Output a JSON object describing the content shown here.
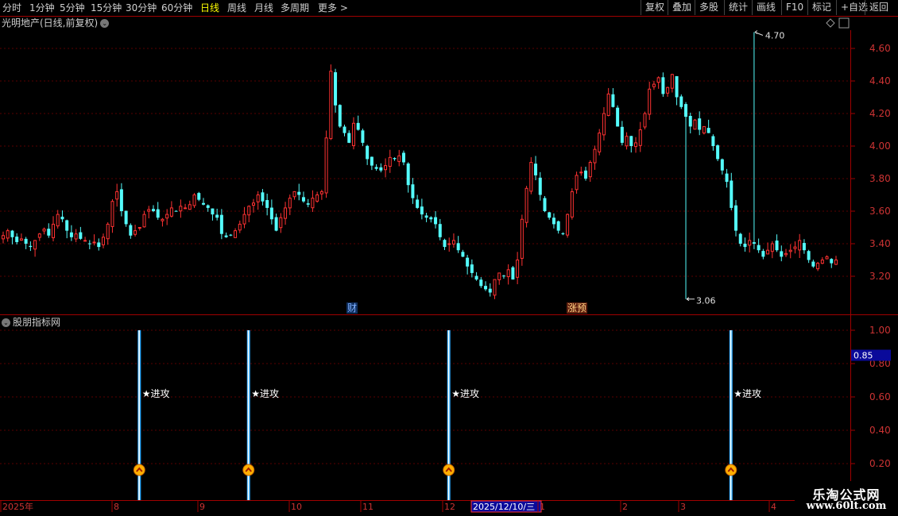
{
  "toolbar": {
    "periods": [
      "分时",
      "1分钟",
      "5分钟",
      "15分钟",
      "30分钟",
      "60分钟",
      "日线",
      "周线",
      "月线",
      "多周期",
      "更多 >"
    ],
    "active_period": "日线",
    "buttons": [
      "复权",
      "叠加",
      "多股",
      "统计",
      "画线",
      "F10",
      "标记",
      "+自选",
      "返回"
    ]
  },
  "main_title": "光明地产(日线,前复权)",
  "indicator_title": "股朋指标网",
  "watermark": {
    "line1": "乐淘公式网",
    "line2": "www.60lt.com"
  },
  "chart_data": [
    {
      "type": "candlestick",
      "title": "光明地产(日线,前复权)",
      "y_ticks": [
        "4.60",
        "4.40",
        "4.20",
        "4.00",
        "3.80",
        "3.60",
        "3.40",
        "3.20"
      ],
      "ylim": [
        3.0,
        4.75
      ],
      "max_label": "4.70",
      "min_label": "3.06",
      "event_markers": [
        "财",
        "涨预"
      ],
      "up_color": "#ff3232",
      "down_color": "#54fcfc",
      "closes": [
        3.45,
        3.48,
        3.44,
        3.41,
        3.43,
        3.4,
        3.38,
        3.42,
        3.46,
        3.49,
        3.45,
        3.52,
        3.58,
        3.55,
        3.48,
        3.44,
        3.46,
        3.43,
        3.42,
        3.4,
        3.41,
        3.38,
        3.44,
        3.52,
        3.66,
        3.72,
        3.6,
        3.52,
        3.45,
        3.48,
        3.5,
        3.58,
        3.61,
        3.6,
        3.56,
        3.55,
        3.58,
        3.62,
        3.6,
        3.63,
        3.62,
        3.64,
        3.7,
        3.67,
        3.64,
        3.62,
        3.58,
        3.56,
        3.46,
        3.44,
        3.45,
        3.48,
        3.52,
        3.58,
        3.63,
        3.65,
        3.7,
        3.66,
        3.62,
        3.55,
        3.48,
        3.56,
        3.62,
        3.68,
        3.72,
        3.7,
        3.66,
        3.64,
        3.68,
        3.7,
        3.72,
        4.05,
        4.46,
        4.25,
        4.12,
        4.08,
        4.02,
        4.14,
        4.1,
        4.02,
        3.92,
        3.88,
        3.86,
        3.85,
        3.88,
        3.93,
        3.92,
        3.94,
        3.9,
        3.76,
        3.68,
        3.62,
        3.58,
        3.56,
        3.55,
        3.52,
        3.44,
        3.38,
        3.4,
        3.42,
        3.36,
        3.32,
        3.26,
        3.22,
        3.18,
        3.14,
        3.12,
        3.1,
        3.18,
        3.22,
        3.2,
        3.24,
        3.18,
        3.3,
        3.55,
        3.74,
        3.9,
        3.82,
        3.7,
        3.6,
        3.56,
        3.52,
        3.48,
        3.46,
        3.58,
        3.72,
        3.82,
        3.84,
        3.8,
        3.9,
        3.98,
        4.08,
        4.2,
        4.32,
        4.24,
        4.12,
        4.02,
        4.06,
        4.0,
        4.02,
        4.1,
        4.2,
        4.35,
        4.38,
        4.42,
        4.32,
        4.36,
        4.44,
        4.3,
        4.24,
        4.18,
        4.12,
        4.16,
        4.1,
        4.12,
        4.08,
        4.0,
        3.92,
        3.85,
        3.78,
        3.62,
        3.48,
        3.4,
        3.38,
        3.42,
        3.4,
        3.36,
        3.32,
        3.36,
        3.4,
        3.36,
        3.32,
        3.34,
        3.36,
        3.38,
        3.42,
        3.36,
        3.3,
        3.26,
        3.28,
        3.3,
        3.32,
        3.28,
        3.3
      ],
      "max_index": 165,
      "min_index": 150
    },
    {
      "type": "bar",
      "title": "股朋指标网",
      "y_ticks": [
        "1.00",
        "0.80",
        "0.60",
        "0.40",
        "0.20"
      ],
      "ylim": [
        0,
        1.05
      ],
      "current_value": "0.85",
      "signal_label": "★进攻",
      "signal_indices": [
        30,
        54,
        98,
        160
      ],
      "signal_values": [
        1,
        1,
        1,
        1
      ]
    }
  ],
  "x_axis": {
    "labels": [
      "2025年",
      "8",
      "9",
      "10",
      "11",
      "12",
      "2025/12/10/三",
      "1",
      "2",
      "3",
      "4"
    ],
    "highlight": "2025/12/10/三"
  }
}
